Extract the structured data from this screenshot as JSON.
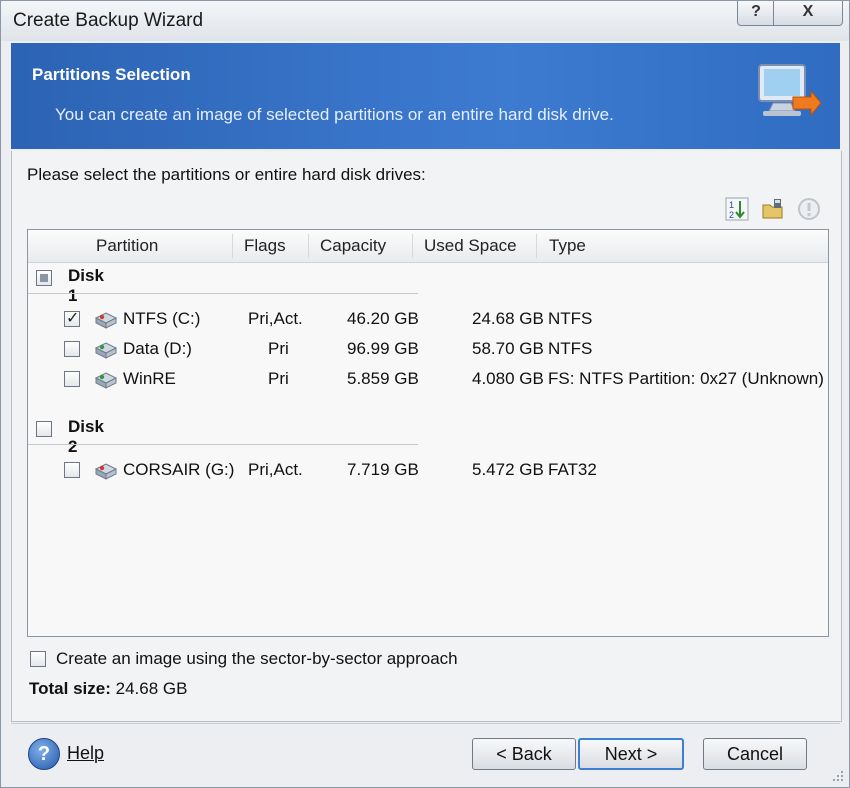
{
  "window": {
    "title": "Create Backup Wizard",
    "help_btn": "?",
    "close_btn": "X"
  },
  "header": {
    "title": "Partitions Selection",
    "subtitle": "You can create an image of selected partitions or an entire hard disk drive."
  },
  "instruction": "Please select the partitions or entire hard disk drives:",
  "columns": [
    "Partition",
    "Flags",
    "Capacity",
    "Used Space",
    "Type"
  ],
  "disks": [
    {
      "label": "Disk 1",
      "state": "partial",
      "partitions": [
        {
          "name": "NTFS (C:)",
          "flags": "Pri,Act.",
          "capacity": "46.20 GB",
          "used": "24.68 GB",
          "type": "NTFS",
          "checked": true
        },
        {
          "name": "Data (D:)",
          "flags": "Pri",
          "capacity": "96.99 GB",
          "used": "58.70 GB",
          "type": "NTFS",
          "checked": false
        },
        {
          "name": "WinRE",
          "flags": "Pri",
          "capacity": "5.859 GB",
          "used": "4.080 GB",
          "type": "FS: NTFS Partition: 0x27 (Unknown)",
          "checked": false
        }
      ]
    },
    {
      "label": "Disk 2",
      "state": "unchecked",
      "partitions": [
        {
          "name": "CORSAIR (G:)",
          "flags": "Pri,Act.",
          "capacity": "7.719 GB",
          "used": "5.472 GB",
          "type": "FAT32",
          "checked": false
        }
      ]
    }
  ],
  "sector_option": "Create an image using the sector-by-sector approach",
  "total_size_label": "Total size:",
  "total_size_value": "24.68 GB",
  "footer": {
    "help": "Help",
    "back": "< Back",
    "next": "Next >",
    "cancel": "Cancel"
  },
  "colors": {
    "header_bg": "#2c63b4",
    "next_focus": "#3d7fd3"
  }
}
